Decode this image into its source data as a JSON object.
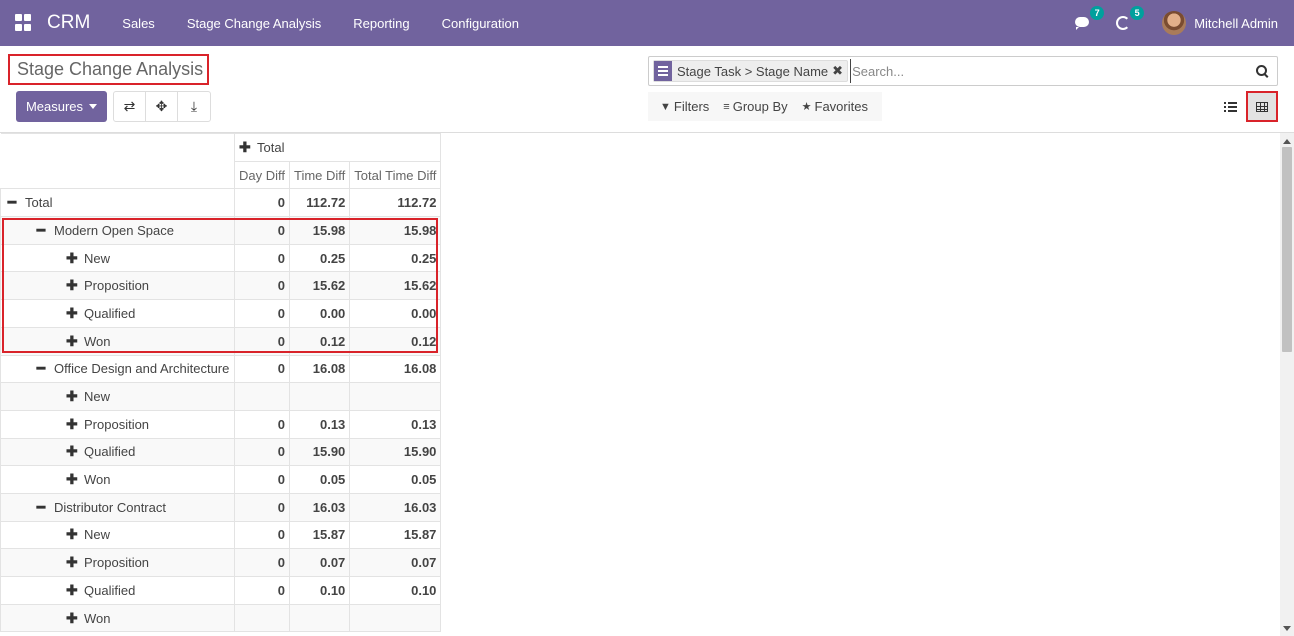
{
  "navbar": {
    "app_name": "CRM",
    "menu": [
      "Sales",
      "Stage Change Analysis",
      "Reporting",
      "Configuration"
    ],
    "messages_count": "7",
    "activities_count": "5",
    "user_name": "Mitchell Admin",
    "color": "#71639e"
  },
  "control_panel": {
    "title": "Stage Change Analysis",
    "measures_label": "Measures",
    "facet_label": "Stage Task > Stage Name",
    "search_placeholder": "Search...",
    "filters_label": "Filters",
    "group_by_label": "Group By",
    "favorites_label": "Favorites"
  },
  "pivot": {
    "col_header": "Total",
    "measures": [
      "Day Diff",
      "Time Diff",
      "Total Time Diff"
    ],
    "rows": [
      {
        "label": "Total",
        "level": 0,
        "expanded": true,
        "values": [
          "0",
          "112.72",
          "112.72"
        ]
      },
      {
        "label": "Modern Open Space",
        "level": 1,
        "expanded": true,
        "values": [
          "0",
          "15.98",
          "15.98"
        ]
      },
      {
        "label": "New",
        "level": 2,
        "expanded": false,
        "values": [
          "0",
          "0.25",
          "0.25"
        ]
      },
      {
        "label": "Proposition",
        "level": 2,
        "expanded": false,
        "values": [
          "0",
          "15.62",
          "15.62"
        ]
      },
      {
        "label": "Qualified",
        "level": 2,
        "expanded": false,
        "values": [
          "0",
          "0.00",
          "0.00"
        ]
      },
      {
        "label": "Won",
        "level": 2,
        "expanded": false,
        "values": [
          "0",
          "0.12",
          "0.12"
        ]
      },
      {
        "label": "Office Design and Architecture",
        "level": 1,
        "expanded": true,
        "values": [
          "0",
          "16.08",
          "16.08"
        ]
      },
      {
        "label": "New",
        "level": 2,
        "expanded": false,
        "values": [
          "",
          "",
          ""
        ]
      },
      {
        "label": "Proposition",
        "level": 2,
        "expanded": false,
        "values": [
          "0",
          "0.13",
          "0.13"
        ]
      },
      {
        "label": "Qualified",
        "level": 2,
        "expanded": false,
        "values": [
          "0",
          "15.90",
          "15.90"
        ]
      },
      {
        "label": "Won",
        "level": 2,
        "expanded": false,
        "values": [
          "0",
          "0.05",
          "0.05"
        ]
      },
      {
        "label": "Distributor Contract",
        "level": 1,
        "expanded": true,
        "values": [
          "0",
          "16.03",
          "16.03"
        ]
      },
      {
        "label": "New",
        "level": 2,
        "expanded": false,
        "values": [
          "0",
          "15.87",
          "15.87"
        ]
      },
      {
        "label": "Proposition",
        "level": 2,
        "expanded": false,
        "values": [
          "0",
          "0.07",
          "0.07"
        ]
      },
      {
        "label": "Qualified",
        "level": 2,
        "expanded": false,
        "values": [
          "0",
          "0.10",
          "0.10"
        ]
      },
      {
        "label": "Won",
        "level": 2,
        "expanded": false,
        "values": [
          "",
          "",
          ""
        ]
      }
    ]
  }
}
